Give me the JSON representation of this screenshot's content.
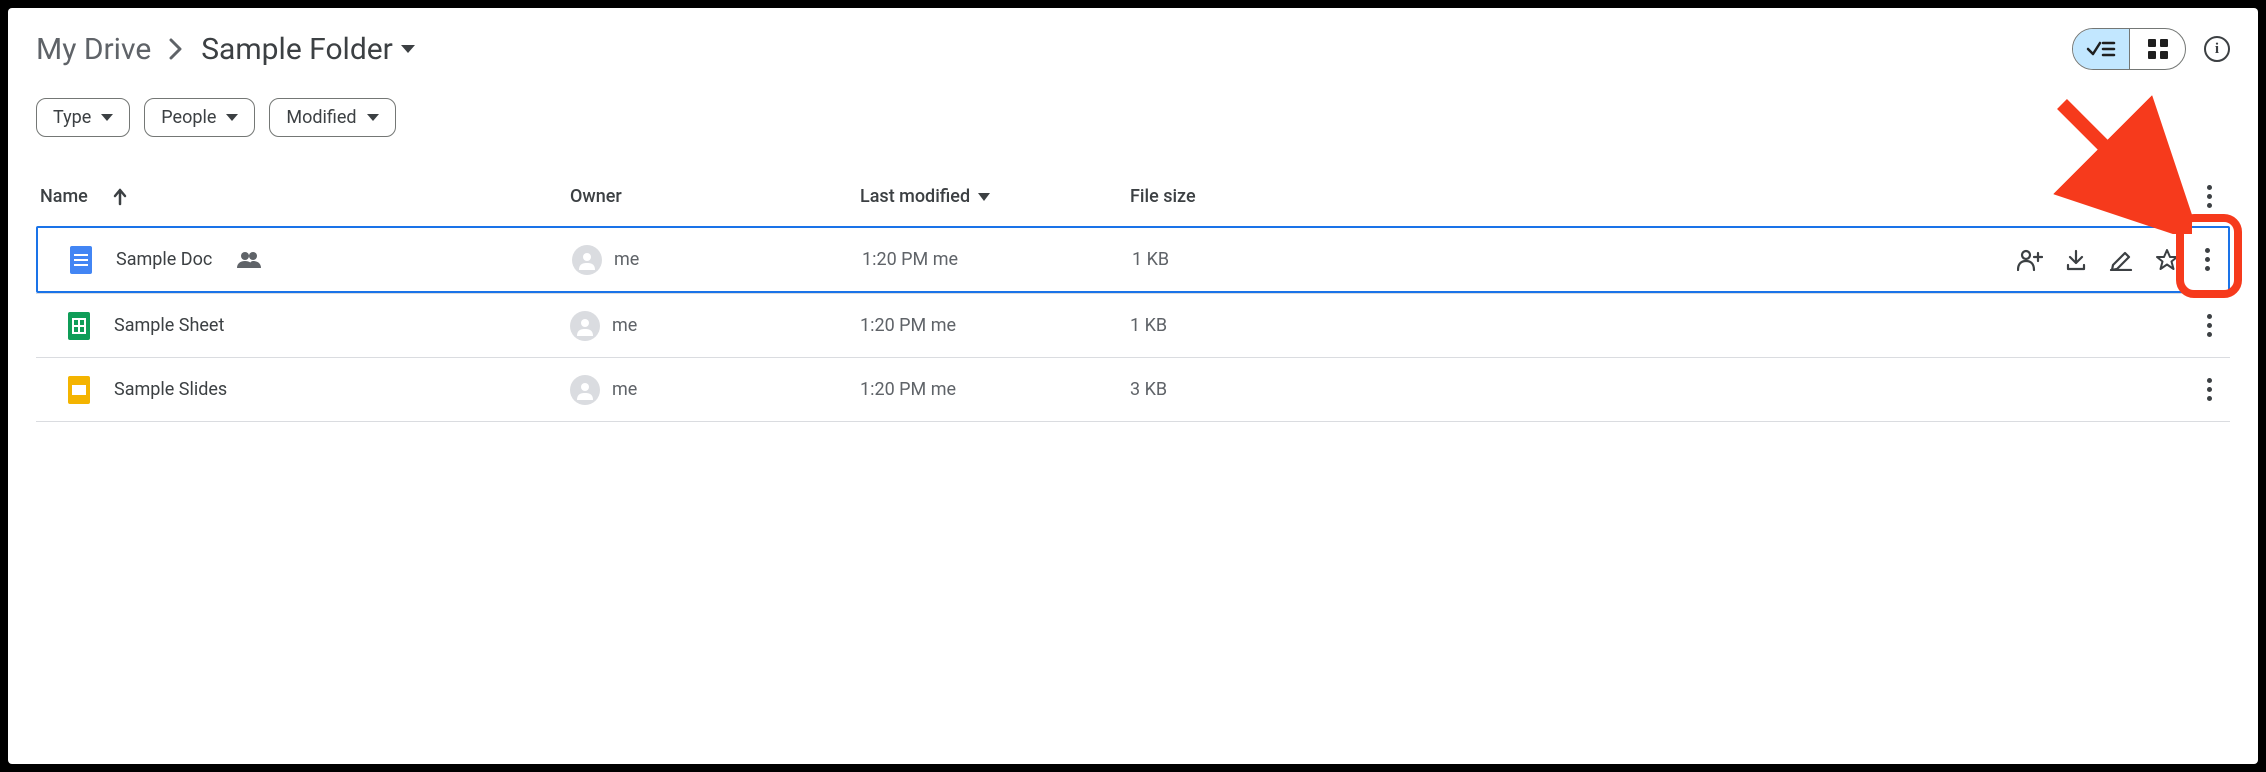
{
  "breadcrumb": {
    "root": "My Drive",
    "current": "Sample Folder"
  },
  "filters": {
    "type": "Type",
    "people": "People",
    "modified": "Modified"
  },
  "columns": {
    "name": "Name",
    "owner": "Owner",
    "modified": "Last modified",
    "size": "File size"
  },
  "files": [
    {
      "name": "Sample Doc",
      "owner": "me",
      "modified": "1:20 PM  me",
      "size": "1 KB"
    },
    {
      "name": "Sample Sheet",
      "owner": "me",
      "modified": "1:20 PM  me",
      "size": "1 KB"
    },
    {
      "name": "Sample Slides",
      "owner": "me",
      "modified": "1:20 PM  me",
      "size": "3 KB"
    }
  ]
}
